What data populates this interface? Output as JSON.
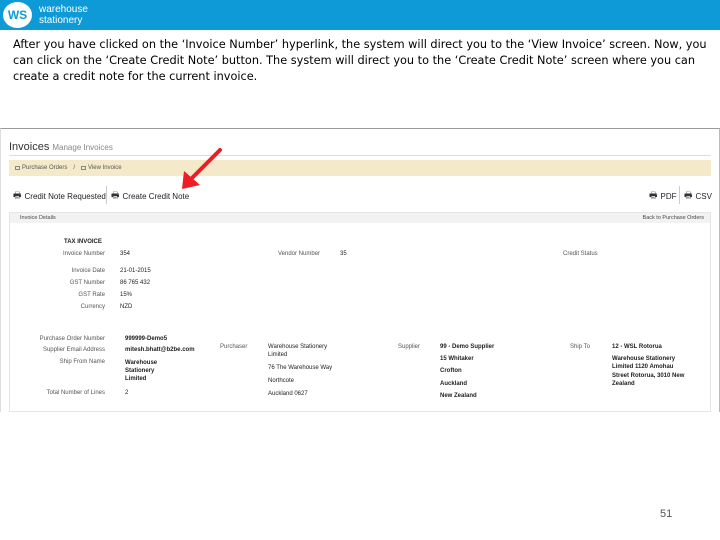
{
  "logo": {
    "initials": "WS",
    "line1": "warehouse",
    "line2": "stationery"
  },
  "intro_text": "After you have clicked on the ‘Invoice Number’ hyperlink, the system will direct you to the ‘View Invoice’ screen. Now, you can click on the ‘Create Credit Note’ button. The system will direct you to the ‘Create Credit Note’ screen where you can create a credit note for the current invoice.",
  "screen": {
    "title": "Invoices",
    "subtitle": "Manage Invoices",
    "tabs": [
      "Purchase Orders",
      "View Invoice"
    ],
    "toolbar": {
      "credit_note_requested": "Credit Note Requested",
      "create_credit_note": "Create Credit Note",
      "pdf": "PDF",
      "csv": "CSV"
    },
    "panel_header": {
      "left": "Invoice Details",
      "right": "Back to Purchase Orders"
    },
    "tax_invoice": "TAX INVOICE",
    "fields": [
      {
        "label": "Invoice Number",
        "value": "354"
      },
      {
        "label": "Invoice Date",
        "value": "21-01-2015"
      },
      {
        "label": "GST Number",
        "value": "86 765 432"
      },
      {
        "label": "GST Rate",
        "value": "15%"
      },
      {
        "label": "Currency",
        "value": "NZD"
      }
    ],
    "vendor_label": "Vendor Number",
    "vendor_value": "35",
    "credit_status_label": "Credit Status",
    "lower_fields": [
      {
        "label": "Purchase Order Number",
        "value": "999999-Demo5"
      },
      {
        "label": "Supplier Email Address",
        "value": "mitesh.bhatt@b2be.com"
      },
      {
        "label": "Ship From Name",
        "value": "Warehouse Stationery Limited"
      },
      {
        "label": "Total Number of Lines",
        "value": "2"
      }
    ],
    "purchaser": {
      "label": "Purchaser",
      "line1": "Warehouse Stationery",
      "line2": "Limited",
      "line3": "76 The Warehouse Way",
      "line4": "Northcote",
      "line5": "Auckland 0627"
    },
    "supplier": {
      "label": "Supplier",
      "line1": "99 - Demo Supplier",
      "line2": "15 Whitaker",
      "line3": "Crofton",
      "line4": "Auckland",
      "line5": "New Zealand"
    },
    "ship_to": {
      "label": "Ship To",
      "line1": "12 - WSL Rotorua",
      "line2": "Warehouse Stationery",
      "line3": "Limited 1120 Amohau",
      "line4": "Street Rotorua, 3010 New",
      "line5": "Zealand"
    }
  },
  "page_number": "51"
}
